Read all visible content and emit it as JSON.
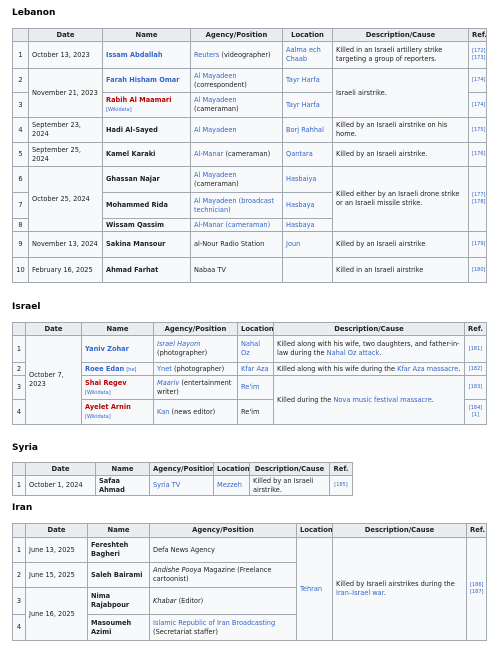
{
  "headers": [
    "Date",
    "Name",
    "Agency/Position",
    "Location",
    "Description/Cause",
    "Ref."
  ],
  "lebanon": {
    "title": "Lebanon",
    "r1": {
      "n": "1",
      "date": "October 13, 2023",
      "name": "Issam Abdallah",
      "agency": "Reuters",
      "agency2": " (videographer)",
      "loc": "Aalma ech Chaab",
      "desc": "Killed in an Israeli artillery strike targeting a group of reporters.",
      "ref1": "[172]",
      "ref2": "[173]"
    },
    "r2": {
      "n": "2",
      "date": "November 21, 2023",
      "name": "Farah Hisham Omar",
      "agency": "Al Mayadeen",
      "agency2": "(correspondent)",
      "loc": "Tayr Harfa",
      "desc": "Israeli airstrike.",
      "ref": "[174]"
    },
    "r3": {
      "n": "3",
      "name": "Rabih Al Maamari",
      "wd": "[Wikidata]",
      "agency": "Al Mayadeen",
      "agency2": "(cameraman)",
      "loc": "Tayr Harfa",
      "ref": "[174]"
    },
    "r4": {
      "n": "4",
      "date": "September 23, 2024",
      "name": "Hadi Al-Sayed",
      "agency": "Al Mayadeen",
      "loc": "Borj Rahhal",
      "desc": "Killed by an Israeli airstrike on his home.",
      "ref": "[175]"
    },
    "r5": {
      "n": "5",
      "date": "September 25, 2024",
      "name": "Kamel Karaki",
      "agency": "Al-Manar",
      "agency2": " (cameraman)",
      "loc": "Qantara",
      "desc": "Killed by an Israeli airstrike.",
      "ref": "[176]"
    },
    "r6": {
      "n": "6",
      "date": "October 25, 2024",
      "name": "Ghassan Najar",
      "agency": "Al Mayadeen",
      "agency2": "(cameraman)",
      "loc": "Hasbaiya",
      "desc": "Killed either by an Israeli drone strike or an Israeli missile strike.",
      "ref1": "[177]",
      "ref2": "[178]"
    },
    "r7": {
      "n": "7",
      "name": "Mohammed Rida",
      "agency": "Al Mayadeen (broadcast technician)",
      "loc": "Hasbaya"
    },
    "r8": {
      "n": "8",
      "name": "Wissam Qassim",
      "agency": "Al-Manar (cameraman)",
      "loc": "Hasbaya"
    },
    "r9": {
      "n": "9",
      "date": "November 13, 2024",
      "name": "Sakina Mansour",
      "agency": "al-Nour Radio Station",
      "loc": "Joun",
      "desc": "Killed by an Israeli airstrike",
      "ref": "[179]"
    },
    "r10": {
      "n": "10",
      "date": "February 16, 2025",
      "name": "Ahmad Farhat",
      "agency": "Nabaa TV",
      "desc": "Killed in an Israeli airstrike",
      "ref": "[180]"
    }
  },
  "israel": {
    "title": "Israel",
    "date": "October 7, 2023",
    "r1": {
      "n": "1",
      "name": "Yaniv Zohar",
      "agency": "Israel Hayom",
      "agency2": "(photographer)",
      "loc": "Nahal Oz",
      "desc": "Killed along with his wife, two daughters, and father-in-law during the ",
      "desc_link": "Nahal Oz attack",
      "desc_end": ".",
      "ref": "[181]"
    },
    "r2": {
      "n": "2",
      "name": "Roee Edan",
      "wd": "[he]",
      "agency": "Ynet",
      "agency2": " (photographer)",
      "loc": "Kfar Aza",
      "desc": "Killed along with his wife during the ",
      "desc_link": "Kfar Aza massacre",
      "desc_end": ".",
      "ref": "[182]"
    },
    "r3": {
      "n": "3",
      "name": "Shai Regev",
      "wd": "[Wikidata]",
      "agency": "Maariv",
      "agency2": " (entertainment writer)",
      "loc": "Re'im",
      "desc": "Killed during the ",
      "desc_link": "Nova music festival massacre",
      "desc_end": ".",
      "ref": "[183]"
    },
    "r4": {
      "n": "4",
      "name": "Ayelet Arnin",
      "wd": "[Wikidata]",
      "agency": "Kan",
      "agency2": " (news editor)",
      "loc": "Re'im",
      "ref1": "[184]",
      "ref2": "[1]"
    }
  },
  "syria": {
    "title": "Syria",
    "r1": {
      "n": "1",
      "date": "October 1, 2024",
      "name": "Safaa Ahmad",
      "agency": "Syria TV",
      "loc": "Mezzeh",
      "desc": "Killed by an Israeli airstrike.",
      "ref": "[185]"
    }
  },
  "iran": {
    "title": "Iran",
    "loc": "Tehran",
    "desc": "Killed by Israeli airstrikes during the ",
    "desc_link": "Iran–Israel war",
    "desc_end": ".",
    "ref1": "[186]",
    "ref2": "[187]",
    "r1": {
      "n": "1",
      "date": "June 13, 2025",
      "name": "Fereshteh Bagheri",
      "agency": "Defa News Agency"
    },
    "r2": {
      "n": "2",
      "date": "June 15, 2025",
      "name": "Saleh Bairami",
      "agency": "Andishe Pooya",
      "agency2": " Magazine (Freelance cartoonist)"
    },
    "r3": {
      "n": "3",
      "date": "June 16, 2025",
      "name": "Nima Rajabpour",
      "agency": "Khabar",
      "agency2": " (Editor)"
    },
    "r4": {
      "n": "4",
      "name": "Masoumeh Azimi",
      "agency": "Islamic Republic of Iran Broadcasting",
      "agency2": "(Secretariat staffer)"
    }
  }
}
